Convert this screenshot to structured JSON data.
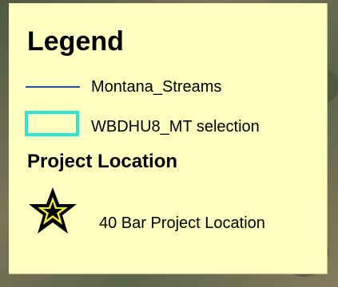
{
  "legend": {
    "title": "Legend",
    "items": [
      {
        "label": "Montana_Streams",
        "symbol": "line",
        "color": "#1f4ea3"
      },
      {
        "label": "WBDHU8_MT selection",
        "symbol": "outlined-rectangle",
        "color": "#2ee5d5"
      }
    ],
    "project_section": {
      "heading": "Project Location",
      "item": {
        "label": "40 Bar Project Location",
        "symbol": "star-icon",
        "fill_color": "#f3ef2a",
        "outline_color": "#000000"
      }
    }
  },
  "colors": {
    "panel_background": "#ffffc0",
    "text": "#000000"
  }
}
